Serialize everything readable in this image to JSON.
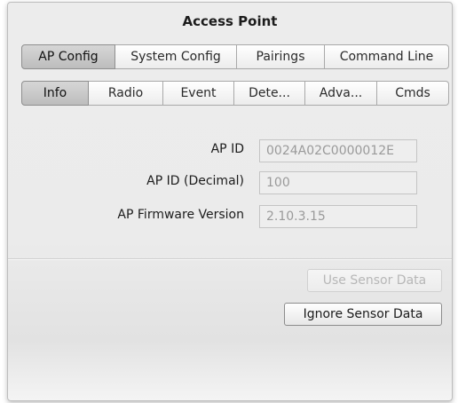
{
  "window": {
    "title": "Access Point"
  },
  "top_tabs": [
    {
      "label": "AP Config",
      "selected": true
    },
    {
      "label": "System Config",
      "selected": false
    },
    {
      "label": "Pairings",
      "selected": false
    },
    {
      "label": "Command Line",
      "selected": false
    }
  ],
  "sub_tabs": [
    {
      "label": "Info",
      "selected": true
    },
    {
      "label": "Radio",
      "selected": false
    },
    {
      "label": "Event",
      "selected": false
    },
    {
      "label": "Dete...",
      "selected": false
    },
    {
      "label": "Adva...",
      "selected": false
    },
    {
      "label": "Cmds",
      "selected": false
    }
  ],
  "fields": {
    "ap_id": {
      "label": "AP ID",
      "value": "0024A02C0000012E"
    },
    "ap_id_decimal": {
      "label": "AP ID (Decimal)",
      "value": "100"
    },
    "firmware": {
      "label": "AP Firmware Version",
      "value": "2.10.3.15"
    }
  },
  "buttons": {
    "use_sensor": {
      "label": "Use Sensor Data",
      "enabled": false
    },
    "ignore_sensor": {
      "label": "Ignore Sensor Data",
      "enabled": true
    }
  }
}
